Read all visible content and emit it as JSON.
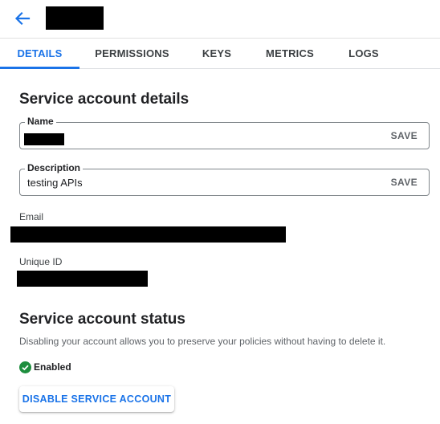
{
  "header": {
    "back_icon": "arrow-back-icon"
  },
  "tabs": [
    {
      "label": "DETAILS",
      "active": true
    },
    {
      "label": "PERMISSIONS",
      "active": false
    },
    {
      "label": "KEYS",
      "active": false
    },
    {
      "label": "METRICS",
      "active": false
    },
    {
      "label": "LOGS",
      "active": false
    }
  ],
  "details": {
    "heading": "Service account details",
    "name_field": {
      "label": "Name",
      "save_label": "SAVE"
    },
    "description_field": {
      "label": "Description",
      "value": "testing APIs",
      "save_label": "SAVE"
    },
    "email_label": "Email",
    "unique_id_label": "Unique ID"
  },
  "status": {
    "heading": "Service account status",
    "description": "Disabling your account allows you to preserve your policies without having to delete it.",
    "state": "Enabled",
    "state_icon": "check-circle-icon",
    "action_label": "DISABLE SERVICE ACCOUNT"
  },
  "colors": {
    "accent": "#1a73e8",
    "success": "#1e8e3e"
  }
}
